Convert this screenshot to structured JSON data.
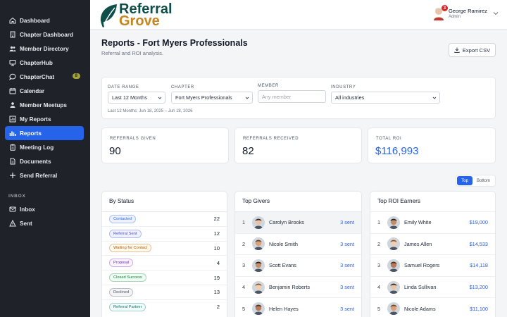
{
  "brand": {
    "line1": "Referral",
    "line2": "Grove",
    "leaf_color": "#0f4f4a",
    "accent_color": "#c6861c"
  },
  "user": {
    "name": "George Ramirez",
    "role": "Admin",
    "notifications": "3"
  },
  "sidebar": {
    "items": [
      {
        "label": "Dashboard",
        "icon": "home-icon"
      },
      {
        "label": "Chapter Dashboard",
        "icon": "building-icon"
      },
      {
        "label": "Member Directory",
        "icon": "users-icon"
      },
      {
        "label": "ChapterHub",
        "icon": "monitor-icon"
      },
      {
        "label": "ChapterChat",
        "icon": "chat-icon",
        "badge": "8"
      },
      {
        "label": "Calendar",
        "icon": "calendar-icon"
      },
      {
        "label": "Member Meetups",
        "icon": "people-icon"
      },
      {
        "label": "My Reports",
        "icon": "bar-chart-icon"
      },
      {
        "label": "Reports",
        "icon": "chart-icon",
        "active": true
      },
      {
        "label": "Meeting Log",
        "icon": "clipboard-icon"
      },
      {
        "label": "Documents",
        "icon": "document-icon"
      },
      {
        "label": "Send Referral",
        "icon": "plus-icon"
      }
    ],
    "inbox_section": "INBOX",
    "inbox_items": [
      {
        "label": "Inbox",
        "icon": "mail-icon"
      },
      {
        "label": "Sent",
        "icon": "send-icon"
      }
    ]
  },
  "page": {
    "title": "Reports - Fort Myers Professionals",
    "subtitle": "Referral and ROI analysis.",
    "export_label": "Export CSV"
  },
  "filters": {
    "date_range": {
      "label": "DATE RANGE",
      "value": "Last 12 Months"
    },
    "chapter": {
      "label": "CHAPTER",
      "value": "Fort Myers Professionals"
    },
    "member": {
      "label": "MEMBER",
      "placeholder": "Any member"
    },
    "industry": {
      "label": "INDUSTRY",
      "value": "All industries"
    },
    "note": "Last 12 Months: Jun 18, 2025 – Jun 18, 2026"
  },
  "stats": [
    {
      "label": "REFERRALS GIVEN",
      "value": "90"
    },
    {
      "label": "REFERRALS RECEIVED",
      "value": "82"
    },
    {
      "label": "TOTAL ROI",
      "value": "$116,993"
    }
  ],
  "toggle": {
    "top": "Top",
    "bottom": "Bottom"
  },
  "by_status": {
    "title": "By Status",
    "rows": [
      {
        "label": "Contacted",
        "count": "22",
        "color": "#2563eb",
        "bg": "#eef2ff"
      },
      {
        "label": "Referral Sent",
        "count": "12",
        "color": "#4f46e5",
        "bg": "#eef2ff"
      },
      {
        "label": "Waiting for Contact",
        "count": "10",
        "color": "#b45309",
        "bg": "#fffbeb"
      },
      {
        "label": "Proposal",
        "count": "4",
        "color": "#7e22ce",
        "bg": "#faf5ff"
      },
      {
        "label": "Closed Success",
        "count": "19",
        "color": "#15803d",
        "bg": "#f0fdf4"
      },
      {
        "label": "Declined",
        "count": "13",
        "color": "#4b5563",
        "bg": "#f3f4f6"
      },
      {
        "label": "Referral Partner",
        "count": "2",
        "color": "#0f766e",
        "bg": "#f0fdfa"
      }
    ]
  },
  "top_givers": {
    "title": "Top Givers",
    "rows": [
      {
        "rank": "1",
        "name": "Carolyn Brooks",
        "value": "3 sent",
        "avatar": "avatar-icon"
      },
      {
        "rank": "2",
        "name": "Nicole Smith",
        "value": "3 sent",
        "avatar": "avatar-icon"
      },
      {
        "rank": "3",
        "name": "Scott Evans",
        "value": "3 sent",
        "avatar": "avatar-icon"
      },
      {
        "rank": "4",
        "name": "Benjamin Roberts",
        "value": "3 sent",
        "avatar": "avatar-icon"
      },
      {
        "rank": "5",
        "name": "Helen Hayes",
        "value": "3 sent",
        "avatar": "avatar-icon"
      }
    ]
  },
  "top_roi": {
    "title": "Top ROI Earners",
    "rows": [
      {
        "rank": "1",
        "name": "Emily White",
        "value": "$19,000",
        "avatar": "avatar-icon"
      },
      {
        "rank": "2",
        "name": "James Allen",
        "value": "$14,533",
        "avatar": "avatar-icon"
      },
      {
        "rank": "3",
        "name": "Samuel Rogers",
        "value": "$14,118",
        "avatar": "avatar-icon"
      },
      {
        "rank": "4",
        "name": "Linda Sullivan",
        "value": "$13,200",
        "avatar": "avatar-icon"
      },
      {
        "rank": "5",
        "name": "Nicole Adams",
        "value": "$11,100",
        "avatar": "avatar-icon"
      }
    ]
  }
}
